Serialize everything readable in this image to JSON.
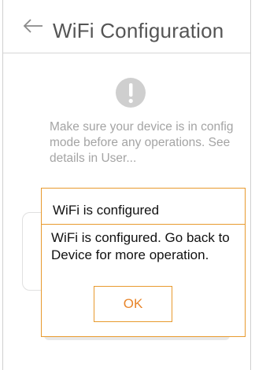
{
  "header": {
    "title": "WiFi  Configuration",
    "back_icon": "arrow-left-icon"
  },
  "notice": {
    "icon": "exclamation-circle-icon",
    "text": "Make sure your device is in config mode before any operations. See details in User..."
  },
  "dialog": {
    "title": "WiFi is configured",
    "message": "WiFi is configured. Go back to Device for more operation.",
    "ok_label": "OK"
  },
  "colors": {
    "accent": "#e89a2e",
    "ok_text": "#e8852a",
    "title_text": "#555555",
    "hint_text": "#a4a4a4",
    "icon_gray": "#cfcfcf"
  }
}
